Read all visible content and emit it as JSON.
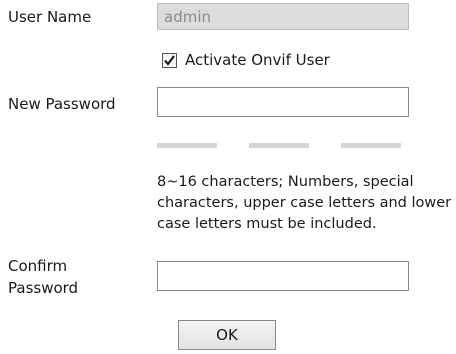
{
  "form": {
    "user_name_label": "User Name",
    "user_name_value": "admin",
    "activate_onvif_label": "Activate Onvif User",
    "activate_onvif_checked": true,
    "new_password_label": "New Password",
    "new_password_value": "",
    "password_strength_segments": 3,
    "password_hint": "8~16 characters; Numbers, special characters, upper case letters and lower case letters must be included.",
    "confirm_password_label": "Confirm Password",
    "confirm_password_value": "",
    "ok_label": "OK"
  },
  "colors": {
    "readonly_background": "#dcdcdc",
    "strength_bar": "#d4d4d4",
    "border": "#8a8a8a"
  }
}
